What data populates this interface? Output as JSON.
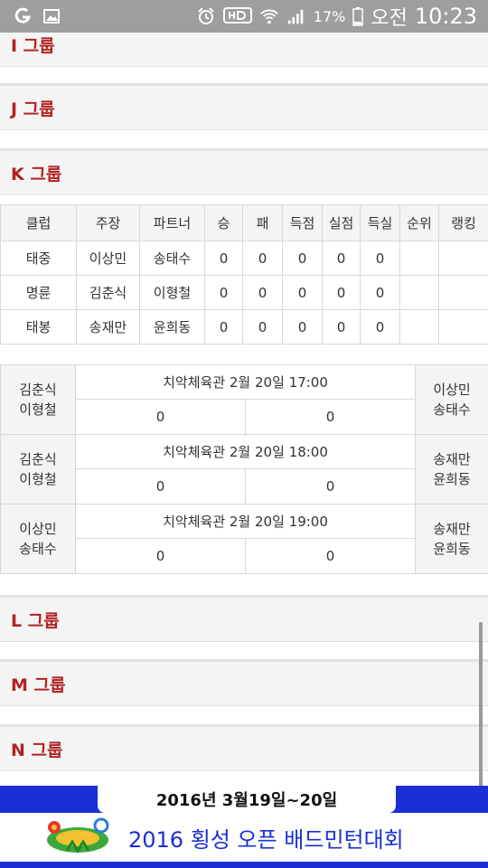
{
  "status_bar": {
    "left_icons": [
      "g-notification-icon",
      "image-notification-icon"
    ],
    "right_icons": [
      "alarm-icon",
      "hd-voice-icon",
      "wifi-icon",
      "signal-icon"
    ],
    "battery_percent": "17%",
    "ampm": "오전",
    "time": "10:23"
  },
  "groups": {
    "i": "I 그룹",
    "j": "J 그룹",
    "k": "K 그룹",
    "l": "L 그룹",
    "m": "M 그룹",
    "n": "N 그룹"
  },
  "standings": {
    "headers": [
      "클럽",
      "주장",
      "파트너",
      "승",
      "패",
      "득점",
      "실점",
      "득실",
      "순위",
      "랭킹"
    ],
    "rows": [
      [
        "태중",
        "이상민",
        "송태수",
        "0",
        "0",
        "0",
        "0",
        "0",
        "",
        ""
      ],
      [
        "명륜",
        "김춘식",
        "이형철",
        "0",
        "0",
        "0",
        "0",
        "0",
        "",
        ""
      ],
      [
        "태봉",
        "송재만",
        "윤희동",
        "0",
        "0",
        "0",
        "0",
        "0",
        "",
        ""
      ]
    ]
  },
  "matches": [
    {
      "left": [
        "김춘식",
        "이형철"
      ],
      "info": "치악체육관 2월 20일  17:00",
      "score_left": "0",
      "score_right": "0",
      "right": [
        "이상민",
        "송태수"
      ]
    },
    {
      "left": [
        "김춘식",
        "이형철"
      ],
      "info": "치악체육관 2월 20일  18:00",
      "score_left": "0",
      "score_right": "0",
      "right": [
        "송재만",
        "윤희동"
      ]
    },
    {
      "left": [
        "이상민",
        "송태수"
      ],
      "info": "치악체육관 2월 20일  19:00",
      "score_left": "0",
      "score_right": "0",
      "right": [
        "송재만",
        "윤희동"
      ]
    }
  ],
  "banner": {
    "date": "2016년 3월19일~20일",
    "title": "2016 횡성 오픈 배드민턴대회"
  },
  "colors": {
    "group_title": "#b22222",
    "banner_blue": "#1a2fd6",
    "status_bar": "#9e9e9e"
  }
}
